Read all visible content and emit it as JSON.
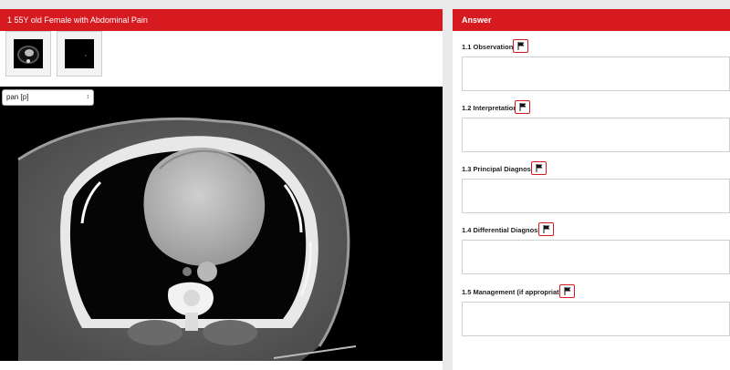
{
  "case": {
    "title": "1 55Y old Female with Abdominal Pain",
    "thumbnails": [
      "ct-chest-axial-thumbnail",
      "ct-dark-series-thumbnail"
    ],
    "tool_select": {
      "selected": "pan [p]"
    }
  },
  "answer": {
    "title": "Answer",
    "questions": [
      {
        "label": "1.1 Observations"
      },
      {
        "label": "1.2 Interpretation"
      },
      {
        "label": "1.3 Principal Diagnosis"
      },
      {
        "label": "1.4 Differential Diagnosis"
      },
      {
        "label": "1.5 Management (if appropriate)"
      }
    ]
  },
  "icons": {
    "flag": "flag-icon",
    "select_arrow": "chevron-updown-icon"
  },
  "colors": {
    "brand_red": "#d71920"
  }
}
